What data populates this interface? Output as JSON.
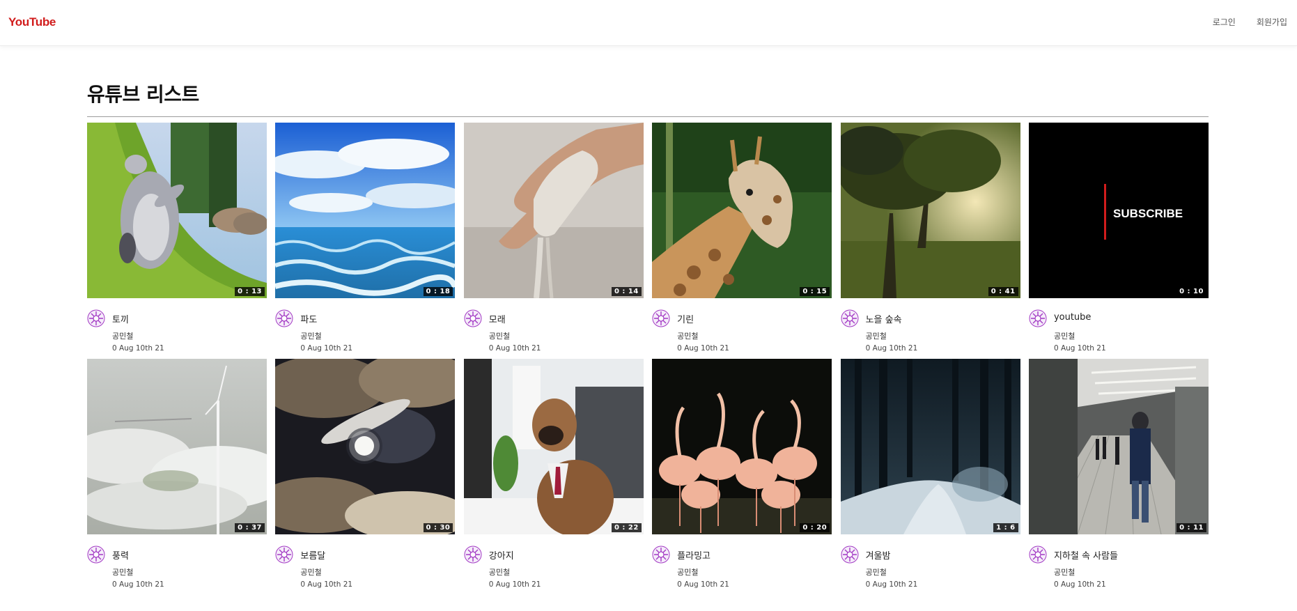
{
  "header": {
    "logo": "YouTube",
    "login_label": "로그인",
    "signup_label": "회원가입"
  },
  "main": {
    "title": "유튜브 리스트"
  },
  "videos": [
    {
      "title": "토끼",
      "channel": "공민철",
      "date": "0 Aug 10th 21",
      "duration": "0 : 13",
      "thumb": "bunny"
    },
    {
      "title": "파도",
      "channel": "공민철",
      "date": "0 Aug 10th 21",
      "duration": "0 : 18",
      "thumb": "waves"
    },
    {
      "title": "모래",
      "channel": "공민철",
      "date": "0 Aug 10th 21",
      "duration": "0 : 14",
      "thumb": "sand"
    },
    {
      "title": "기린",
      "channel": "공민철",
      "date": "0 Aug 10th 21",
      "duration": "0 : 15",
      "thumb": "giraffe"
    },
    {
      "title": "노을 숲속",
      "channel": "공민철",
      "date": "0 Aug 10th 21",
      "duration": "0 : 41",
      "thumb": "forest"
    },
    {
      "title": "youtube",
      "channel": "공민철",
      "date": "0 Aug 10th 21",
      "duration": "0 : 10",
      "thumb": "subscribe",
      "thumb_text": "SUBSCRIBE"
    },
    {
      "title": "풍력",
      "channel": "공민철",
      "date": "0 Aug 10th 21",
      "duration": "0 : 37",
      "thumb": "wind"
    },
    {
      "title": "보름달",
      "channel": "공민철",
      "date": "0 Aug 10th 21",
      "duration": "0 : 30",
      "thumb": "moon"
    },
    {
      "title": "강아지",
      "channel": "공민철",
      "date": "0 Aug 10th 21",
      "duration": "0 : 22",
      "thumb": "dog"
    },
    {
      "title": "플라밍고",
      "channel": "공민철",
      "date": "0 Aug 10th 21",
      "duration": "0 : 20",
      "thumb": "flamingo"
    },
    {
      "title": "겨울밤",
      "channel": "공민철",
      "date": "0 Aug 10th 21",
      "duration": "1 : 6",
      "thumb": "winter"
    },
    {
      "title": "지하철 속 사람들",
      "channel": "공민철",
      "date": "0 Aug 10th 21",
      "duration": "0 : 11",
      "thumb": "subway"
    }
  ],
  "colors": {
    "logo": "#d11c1c",
    "avatar": "#a33ac4",
    "rule": "#9a9a9a"
  }
}
